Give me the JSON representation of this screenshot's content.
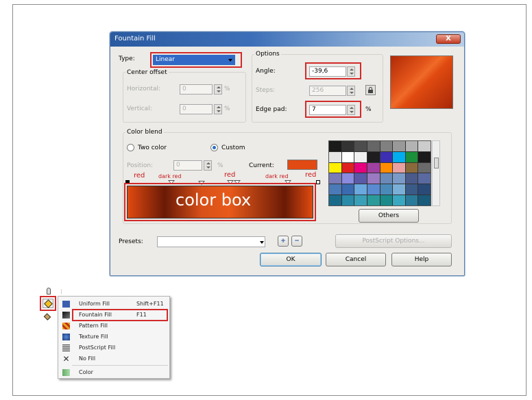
{
  "dialog": {
    "title": "Fountain Fill",
    "close_label": "X",
    "type_label": "Type:",
    "type_value": "Linear",
    "center_offset_label": "Center offset",
    "horizontal_label": "Horizontal:",
    "horizontal_value": "0",
    "vertical_label": "Vertical:",
    "vertical_value": "0",
    "percent_unit": "%",
    "options_label": "Options",
    "angle_label": "Angle:",
    "angle_value": "-39,6",
    "steps_label": "Steps:",
    "steps_value": "256",
    "edge_pad_label": "Edge pad:",
    "edge_pad_value": "7",
    "color_blend_label": "Color blend",
    "two_color_label": "Two color",
    "custom_label": "Custom",
    "position_label": "Position:",
    "position_value": "0",
    "current_label": "Current:",
    "current_color": "#e14a12",
    "color_box_label": "color box",
    "gradient_labels": [
      "red",
      "dark red",
      "red",
      "dark red",
      "red"
    ],
    "others_label": "Others",
    "presets_label": "Presets:",
    "presets_value": "",
    "add_preset_label": "+",
    "remove_preset_label": "−",
    "postscript_options_label": "PostScript Options...",
    "ok_label": "OK",
    "cancel_label": "Cancel",
    "help_label": "Help",
    "palette_colors": [
      "#1a1a1a",
      "#333333",
      "#4d4d4d",
      "#666666",
      "#808080",
      "#999999",
      "#b3b3b3",
      "#cccccc",
      "#e6e6e6",
      "#ffffff",
      "#f0f0f0",
      "#1e1e1e",
      "#3d2fb3",
      "#00aeef",
      "#1b8f3a",
      "#1a1a1a",
      "#ffef00",
      "#e02020",
      "#e6007e",
      "#a040a0",
      "#ff8c00",
      "#e8a0a0",
      "#8a6a3a",
      "#6a6a6a",
      "#7a7ab8",
      "#8a8ae0",
      "#5a5aa8",
      "#9a7ac0",
      "#6a8ab8",
      "#7a9ac8",
      "#4a5a8a",
      "#5a6aa0",
      "#4a7ab8",
      "#3a6ab0",
      "#6aa8e0",
      "#5a8ad0",
      "#4a8ab8",
      "#7ab0d8",
      "#3a5a88",
      "#2a4a78",
      "#1a6a8a",
      "#2a8aa8",
      "#3aa0b8",
      "#2a9a9a",
      "#1a8a8a",
      "#3aa8c0",
      "#2a7a9a",
      "#1a5a7a"
    ]
  },
  "menu": {
    "items": [
      {
        "icon": "uniform-fill-icon",
        "label": "Uniform Fill",
        "shortcut": "Shift+F11"
      },
      {
        "icon": "fountain-fill-icon",
        "label": "Fountain Fill",
        "shortcut": "F11"
      },
      {
        "icon": "pattern-fill-icon",
        "label": "Pattern Fill",
        "shortcut": ""
      },
      {
        "icon": "texture-fill-icon",
        "label": "Texture Fill",
        "shortcut": ""
      },
      {
        "icon": "postscript-fill-icon",
        "label": "PostScript Fill",
        "shortcut": ""
      },
      {
        "icon": "no-fill-icon",
        "label": "No Fill",
        "shortcut": ""
      },
      {
        "icon": "color-icon",
        "label": "Color",
        "shortcut": ""
      }
    ]
  }
}
